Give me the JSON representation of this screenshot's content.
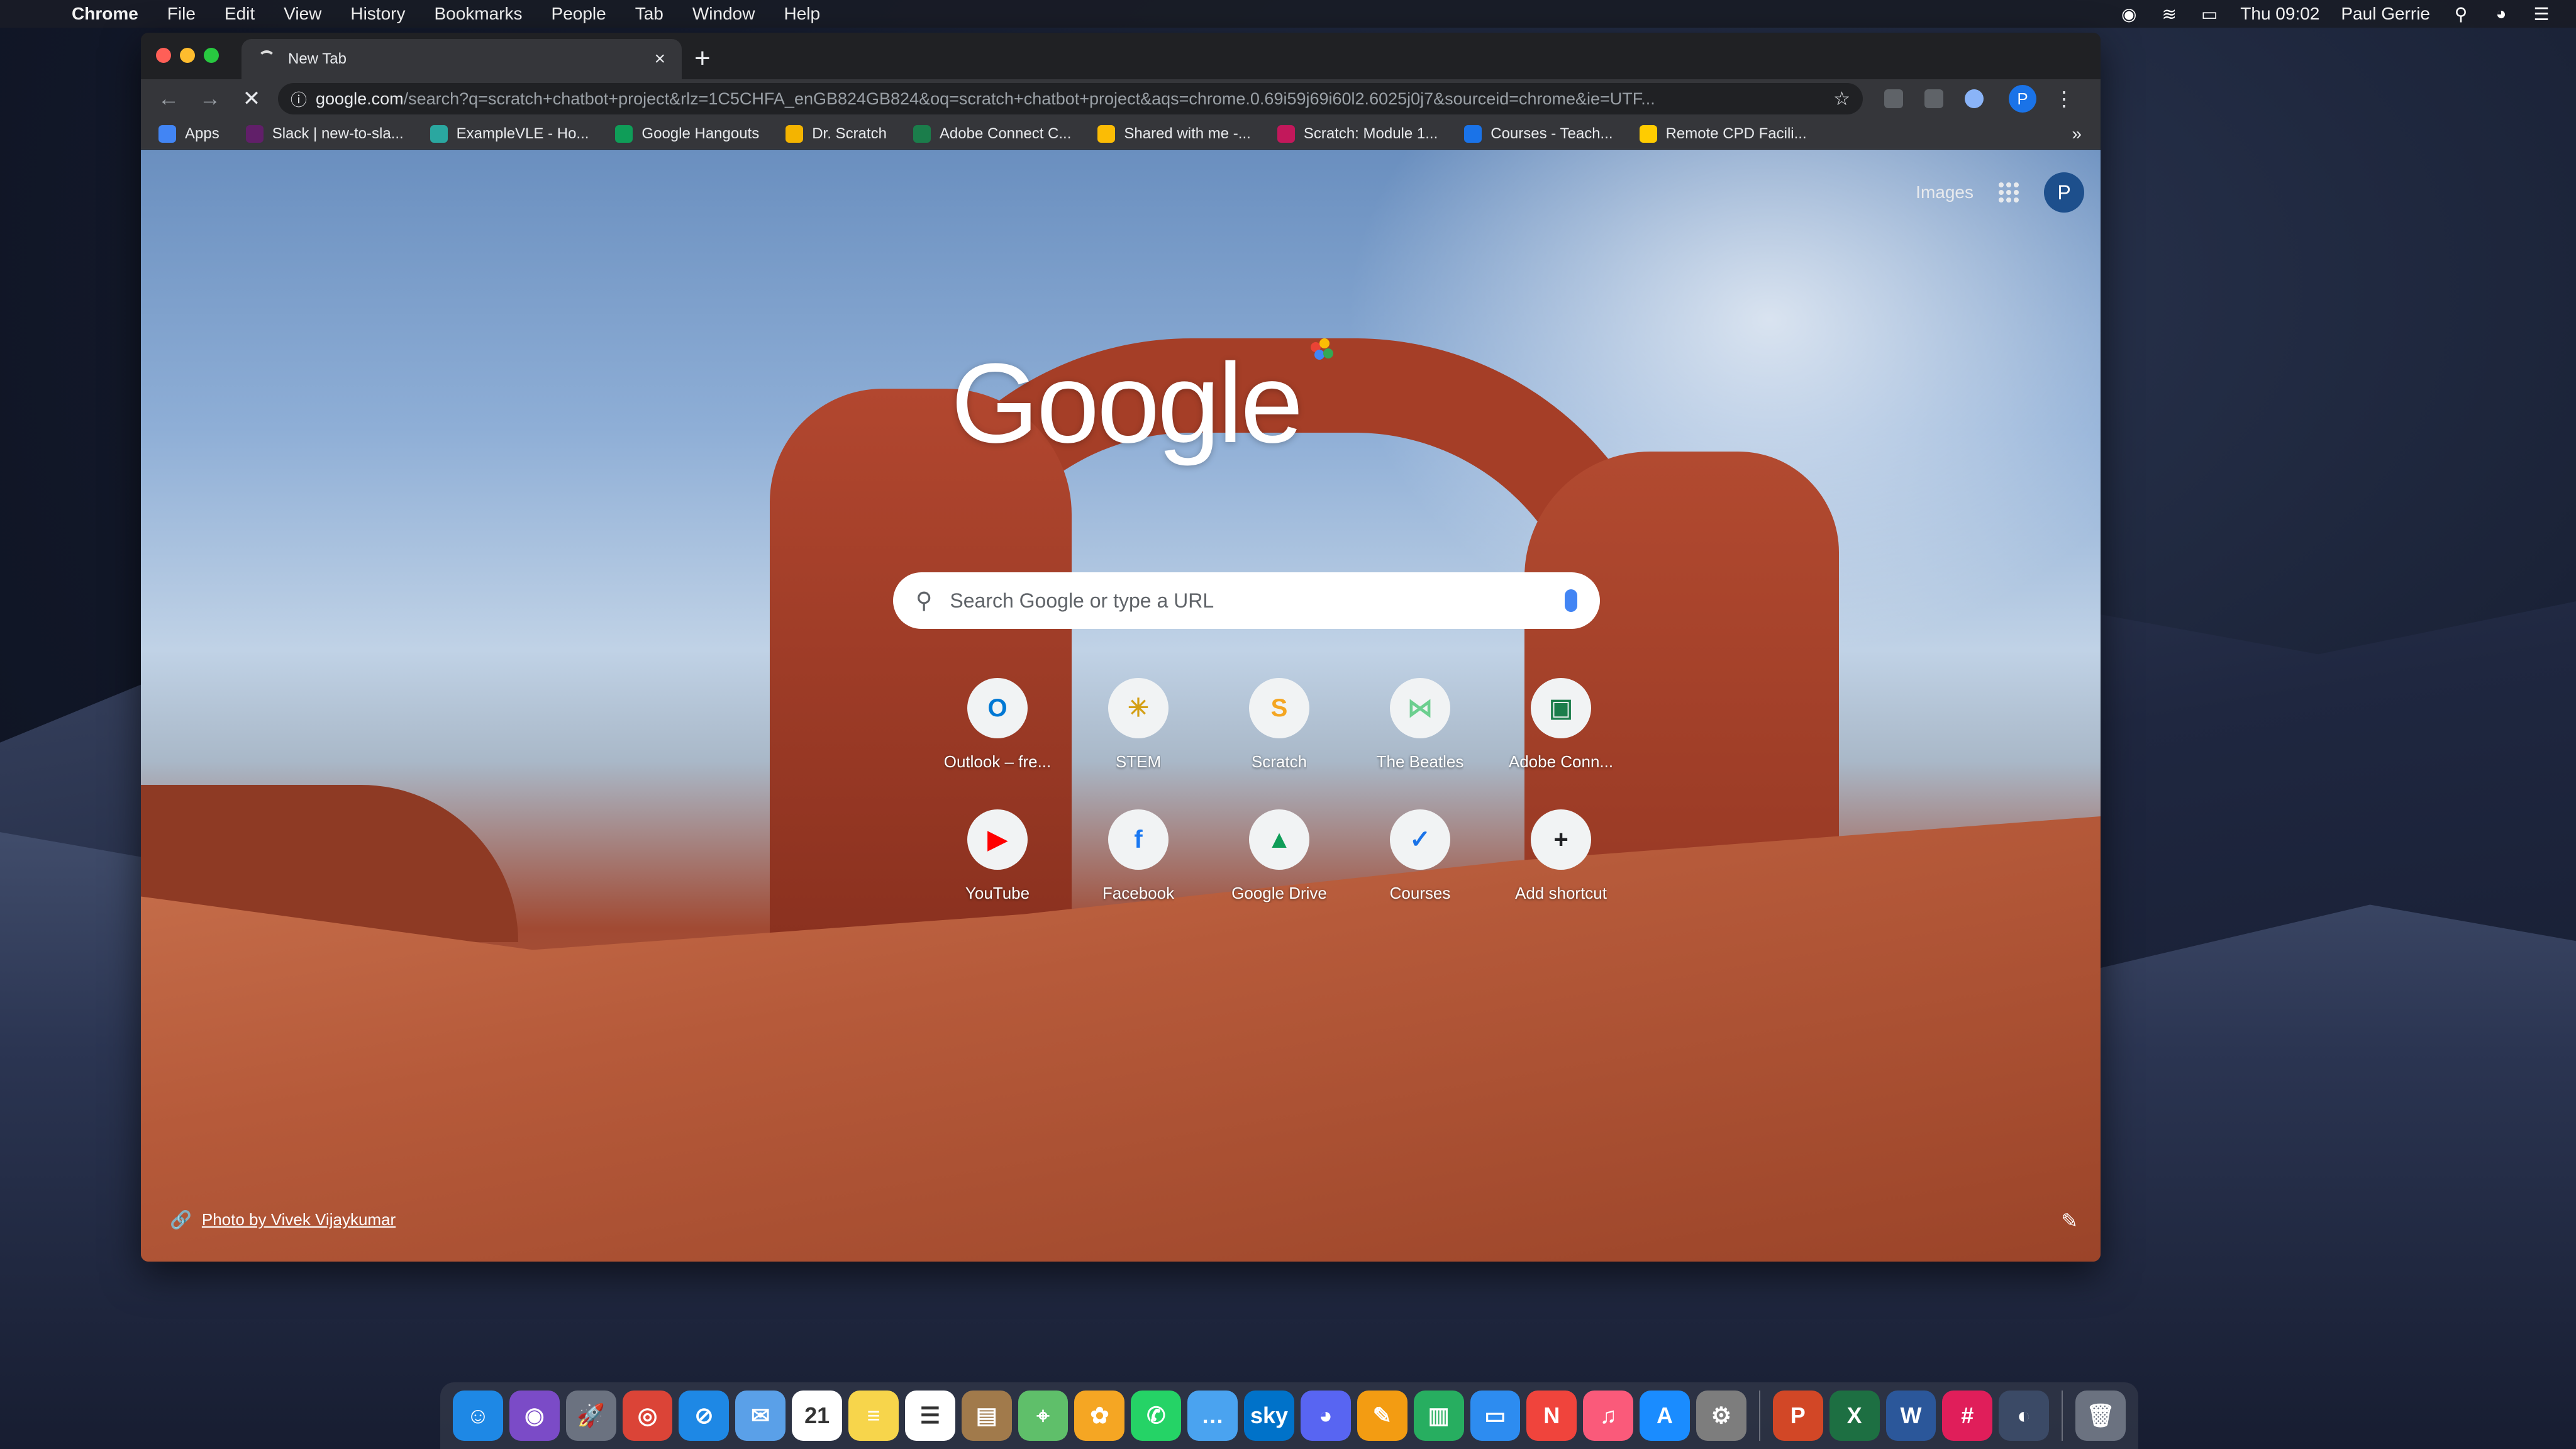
{
  "menubar": {
    "app_name": "Chrome",
    "items": [
      "File",
      "Edit",
      "View",
      "History",
      "Bookmarks",
      "People",
      "Tab",
      "Window",
      "Help"
    ],
    "clock": "Thu 09:02",
    "user": "Paul Gerrie"
  },
  "browser": {
    "tab_title": "New Tab",
    "url_host": "google.com",
    "url_path": "/search?q=scratch+chatbot+project&rlz=1C5CHFA_enGB824GB824&oq=scratch+chatbot+project&aqs=chrome.0.69i59j69i60l2.6025j0j7&sourceid=chrome&ie=UTF...",
    "profile_initial": "P",
    "bookmarks": [
      {
        "label": "Apps",
        "color": "#4285f4"
      },
      {
        "label": "Slack | new-to-sla...",
        "color": "#611f69"
      },
      {
        "label": "ExampleVLE - Ho...",
        "color": "#2aa7a0"
      },
      {
        "label": "Google Hangouts",
        "color": "#0f9d58"
      },
      {
        "label": "Dr. Scratch",
        "color": "#f4b400"
      },
      {
        "label": "Adobe Connect C...",
        "color": "#1b7d4b"
      },
      {
        "label": "Shared with me -...",
        "color": "#fbbc05"
      },
      {
        "label": "Scratch: Module 1...",
        "color": "#c2185b"
      },
      {
        "label": "Courses - Teach...",
        "color": "#1a73e8"
      },
      {
        "label": "Remote CPD Facili...",
        "color": "#ffcc00"
      }
    ],
    "bookmarks_more": "»"
  },
  "newtab": {
    "images_link": "Images",
    "avatar_initial": "P",
    "logo": "Google",
    "search_placeholder": "Search Google or type a URL",
    "shortcuts": [
      {
        "label": "Outlook – fre...",
        "glyph": "O",
        "color": "#0078d4"
      },
      {
        "label": "STEM",
        "glyph": "✳",
        "color": "#d4a017"
      },
      {
        "label": "Scratch",
        "glyph": "S",
        "color": "#f4a623"
      },
      {
        "label": "The Beatles",
        "glyph": "⋈",
        "color": "#6ccf8f"
      },
      {
        "label": "Adobe Conn...",
        "glyph": "▣",
        "color": "#1b7d4b"
      },
      {
        "label": "YouTube",
        "glyph": "▶",
        "color": "#ff0000"
      },
      {
        "label": "Facebook",
        "glyph": "f",
        "color": "#1877f2"
      },
      {
        "label": "Google Drive",
        "glyph": "▲",
        "color": "#0f9d58"
      },
      {
        "label": "Courses",
        "glyph": "✓",
        "color": "#1a73e8"
      },
      {
        "label": "Add shortcut",
        "glyph": "+",
        "color": "#202124"
      }
    ],
    "photo_credit": "Photo by Vivek Vijaykumar"
  },
  "dock": {
    "apps": [
      {
        "name": "finder",
        "glyph": "☺",
        "color": "#1e88e5"
      },
      {
        "name": "siri",
        "glyph": "◉",
        "color": "#7b4bc7"
      },
      {
        "name": "launchpad",
        "glyph": "🚀",
        "color": "#6b7280"
      },
      {
        "name": "chrome",
        "glyph": "◎",
        "color": "#db4437"
      },
      {
        "name": "safari",
        "glyph": "⊘",
        "color": "#1e88e5"
      },
      {
        "name": "mail",
        "glyph": "✉",
        "color": "#5aa0e8"
      },
      {
        "name": "calendar",
        "glyph": "21",
        "color": "#ffffff"
      },
      {
        "name": "notes",
        "glyph": "≡",
        "color": "#f7d54b"
      },
      {
        "name": "reminders",
        "glyph": "☰",
        "color": "#ffffff"
      },
      {
        "name": "notebook",
        "glyph": "▤",
        "color": "#a17a4b"
      },
      {
        "name": "maps",
        "glyph": "⌖",
        "color": "#5fbf6a"
      },
      {
        "name": "photos",
        "glyph": "✿",
        "color": "#f5a623"
      },
      {
        "name": "whatsapp",
        "glyph": "✆",
        "color": "#25d366"
      },
      {
        "name": "messages",
        "glyph": "…",
        "color": "#4aa3f0"
      },
      {
        "name": "sky",
        "glyph": "sky",
        "color": "#0072c9"
      },
      {
        "name": "discord",
        "glyph": "◕",
        "color": "#5865f2"
      },
      {
        "name": "pages",
        "glyph": "✎",
        "color": "#f39c12"
      },
      {
        "name": "numbers",
        "glyph": "▥",
        "color": "#27ae60"
      },
      {
        "name": "keynote",
        "glyph": "▭",
        "color": "#2d8cf0"
      },
      {
        "name": "news",
        "glyph": "N",
        "color": "#f0443c"
      },
      {
        "name": "music",
        "glyph": "♫",
        "color": "#fa5a7a"
      },
      {
        "name": "app-store",
        "glyph": "A",
        "color": "#1a8cff"
      },
      {
        "name": "system-preferences",
        "glyph": "⚙",
        "color": "#7d7d7d"
      },
      {
        "name": "powerpoint",
        "glyph": "P",
        "color": "#d24726"
      },
      {
        "name": "excel",
        "glyph": "X",
        "color": "#1d6f42"
      },
      {
        "name": "word",
        "glyph": "W",
        "color": "#2b579a"
      },
      {
        "name": "slack",
        "glyph": "#",
        "color": "#e01e5a"
      },
      {
        "name": "screen-share",
        "glyph": "◐",
        "color": "#3b4a66"
      },
      {
        "name": "trash",
        "glyph": "🗑",
        "color": "#6b7280"
      }
    ]
  }
}
